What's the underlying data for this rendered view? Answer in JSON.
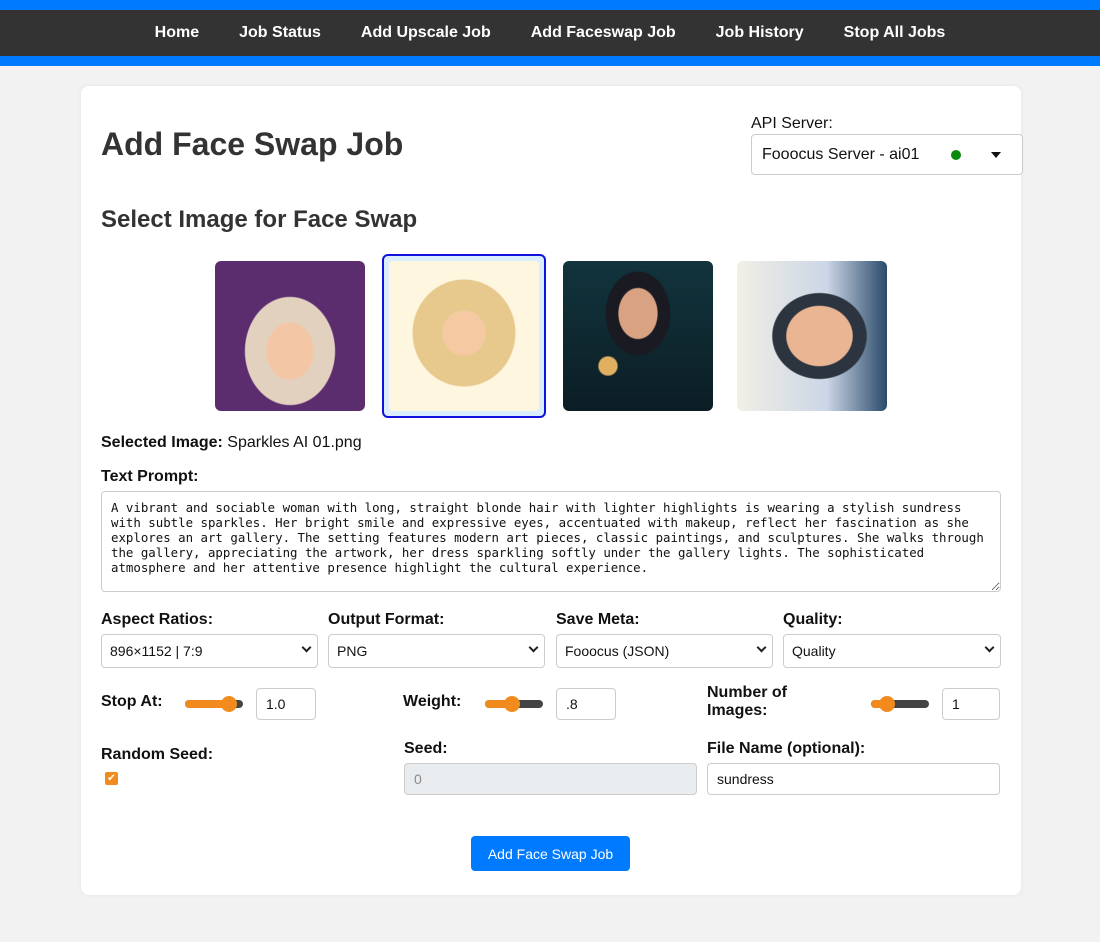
{
  "nav": {
    "items": [
      {
        "label": "Home"
      },
      {
        "label": "Job Status"
      },
      {
        "label": "Add Upscale Job"
      },
      {
        "label": "Add Faceswap Job"
      },
      {
        "label": "Job History"
      },
      {
        "label": "Stop All Jobs"
      }
    ]
  },
  "page": {
    "title": "Add Face Swap Job",
    "section_title": "Select Image for Face Swap"
  },
  "api_server": {
    "label": "API Server:",
    "selected": "Fooocus Server - ai01",
    "status_color": "#0a8a0a",
    "icon": "caret-down-icon"
  },
  "gallery": {
    "images": [
      {
        "name": "woman-purple-background",
        "selected": false
      },
      {
        "name": "woman-blonde-sparkles",
        "selected": true
      },
      {
        "name": "man-stage-lights",
        "selected": false
      },
      {
        "name": "man-closeup-sparkles",
        "selected": false
      }
    ],
    "selection_color": "#1010e0"
  },
  "selected_image": {
    "label": "Selected Image:",
    "value": "Sparkles AI 01.png"
  },
  "prompt": {
    "label": "Text Prompt:",
    "value": "A vibrant and sociable woman with long, straight blonde hair with lighter highlights is wearing a stylish sundress with subtle sparkles. Her bright smile and expressive eyes, accentuated with makeup, reflect her fascination as she explores an art gallery. The setting features modern art pieces, classic paintings, and sculptures. She walks through the gallery, appreciating the artwork, her dress sparkling softly under the gallery lights. The sophisticated atmosphere and her attentive presence highlight the cultural experience."
  },
  "options": {
    "aspect_ratio": {
      "label": "Aspect Ratios:",
      "value": "896×1152 | 7:9"
    },
    "output_format": {
      "label": "Output Format:",
      "value": "PNG"
    },
    "save_meta": {
      "label": "Save Meta:",
      "value": "Fooocus (JSON)"
    },
    "quality": {
      "label": "Quality:",
      "value": "Quality"
    }
  },
  "sliders": {
    "stop_at": {
      "label": "Stop At:",
      "value": "1.0",
      "fraction": 0.75
    },
    "weight": {
      "label": "Weight:",
      "value": ".8",
      "fraction": 0.47
    },
    "num_images": {
      "label": "Number of Images:",
      "label_line1": "Number of",
      "label_line2": "Images:",
      "value": "1",
      "fraction": 0.28
    }
  },
  "seed": {
    "random_label": "Random Seed:",
    "random_checked": true,
    "label": "Seed:",
    "value": "0"
  },
  "file_name": {
    "label": "File Name (optional):",
    "value": "sundress"
  },
  "submit": {
    "label": "Add Face Swap Job",
    "color": "#007bff"
  },
  "accent_color": "#f28b1e"
}
